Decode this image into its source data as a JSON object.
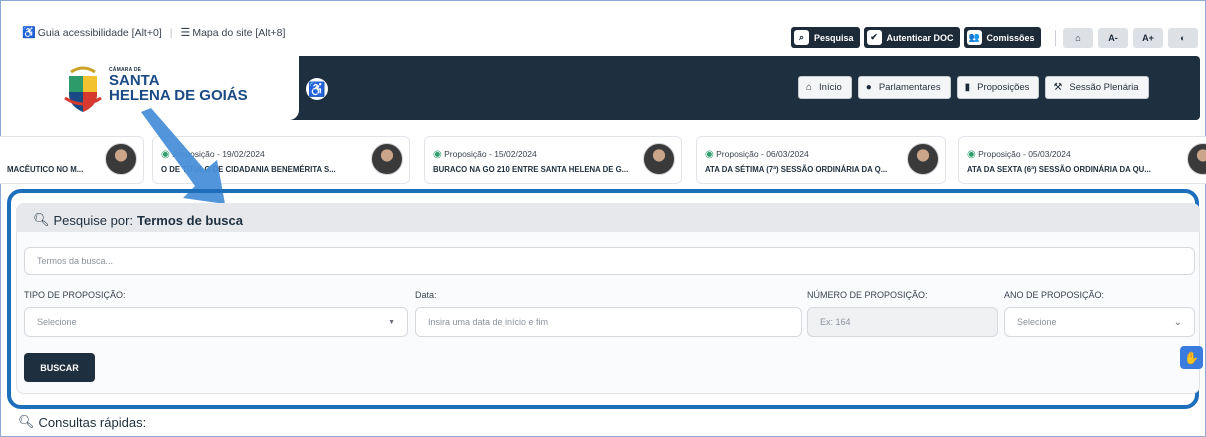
{
  "accessibility": {
    "guide": "Guia acessibilidade [Alt+0]",
    "sitemap": "Mapa do site [Alt+8]",
    "separator": "|"
  },
  "top_buttons": [
    {
      "label": "Pesquisa",
      "icon": "search-icon"
    },
    {
      "label": "Autenticar DOC",
      "icon": "check-circle-icon"
    },
    {
      "label": "Comissões",
      "icon": "group-icon"
    }
  ],
  "font_tools": {
    "home": "⌂",
    "decrease": "A-",
    "increase": "A+",
    "contrast": "◐"
  },
  "logo": {
    "small": "CÂMARA DE",
    "line1": "SANTA",
    "line2": "HELENA DE GOIÁS"
  },
  "nav": [
    {
      "label": "Início",
      "icon": "home-icon"
    },
    {
      "label": "Parlamentares",
      "icon": "user-icon"
    },
    {
      "label": "Proposições",
      "icon": "document-icon"
    },
    {
      "label": "Sessão Plenária",
      "icon": "gavel-icon"
    }
  ],
  "carousel": [
    {
      "date": "",
      "title": "MACÊUTICO NO M..."
    },
    {
      "date": "Proposição - 19/02/2024",
      "title": "O DE TÍTULO DE CIDADANIA BENEMÉRITA S..."
    },
    {
      "date": "Proposição - 15/02/2024",
      "title": "BURACO NA GO 210 ENTRE SANTA HELENA DE G..."
    },
    {
      "date": "Proposição - 06/03/2024",
      "title": "ATA DA SÉTIMA (7ª) SESSÃO ORDINÁRIA DA Q..."
    },
    {
      "date": "Proposição - 05/03/2024",
      "title": "ATA DA SEXTA (6ª) SESSÃO ORDINÁRIA DA QU..."
    }
  ],
  "search": {
    "title_prefix": "Pesquise por:",
    "title_bold": "Termos de busca",
    "terms_placeholder": "Termos da busca...",
    "type_label": "TIPO DE PROPOSIÇÃO:",
    "type_value": "Selecione",
    "date_label": "Data:",
    "date_placeholder": "Insira uma data de início e fim",
    "number_label": "NÚMERO DE PROPOSIÇÃO:",
    "number_placeholder": "Ex: 164",
    "year_label": "ANO DE PROPOSIÇÃO:",
    "year_value": "Selecione",
    "button": "BUSCAR"
  },
  "quick": "Consultas rápidas:",
  "colors": {
    "dark": "#1e2f3f",
    "highlight": "#1d6fbc",
    "libras": "#3a7be0"
  }
}
